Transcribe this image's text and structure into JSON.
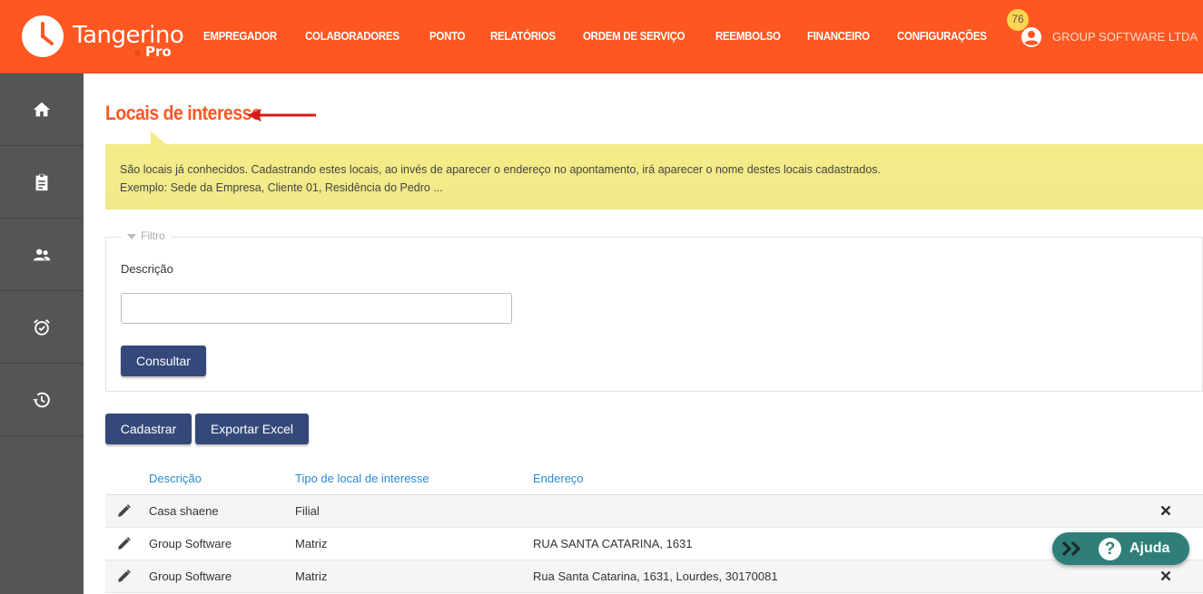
{
  "brand": {
    "name": "Tangerino",
    "sub": "Pro"
  },
  "nav": [
    "EMPREGADOR",
    "COLABORADORES",
    "PONTO",
    "RELATÓRIOS",
    "ORDEM DE SERVIÇO",
    "REEMBOLSO",
    "FINANCEIRO",
    "CONFIGURAÇÕES"
  ],
  "header": {
    "notifications": "76",
    "company": "GROUP SOFTWARE LTDA"
  },
  "sidebar": {
    "icons": [
      "home-icon",
      "clipboard-icon",
      "people-icon",
      "alarm-icon",
      "history-icon"
    ]
  },
  "page": {
    "title": "Locais de interesse",
    "info_line1": "São locais já conhecidos. Cadastrando estes locais, ao invés de aparecer o endereço no apontamento, irá aparecer o nome destes locais cadastrados.",
    "info_line2": "Exemplo: Sede da Empresa, Cliente 01, Residência do Pedro ..."
  },
  "filter": {
    "legend": "Filtro",
    "description_label": "Descrição",
    "description_value": "",
    "search_button": "Consultar"
  },
  "actions": {
    "create": "Cadastrar",
    "export": "Exportar Excel"
  },
  "table": {
    "columns": [
      "Descrição",
      "Tipo de local de interesse",
      "Endereço"
    ],
    "rows": [
      {
        "descricao": "Casa shaene",
        "tipo": "Filial",
        "endereco": ""
      },
      {
        "descricao": "Group Software",
        "tipo": "Matriz",
        "endereco": "RUA SANTA CATARINA, 1631"
      },
      {
        "descricao": "Group Software",
        "tipo": "Matriz",
        "endereco": "Rua Santa Catarina, 1631, Lourdes, 30170081"
      }
    ]
  },
  "help": {
    "label": "Ajuda",
    "symbol": "?"
  },
  "colors": {
    "brand": "#ff5722",
    "sidebar": "#555555",
    "button": "#34497a",
    "info": "#f4ec88",
    "link": "#2a8ad4",
    "help": "#2f7f78"
  }
}
